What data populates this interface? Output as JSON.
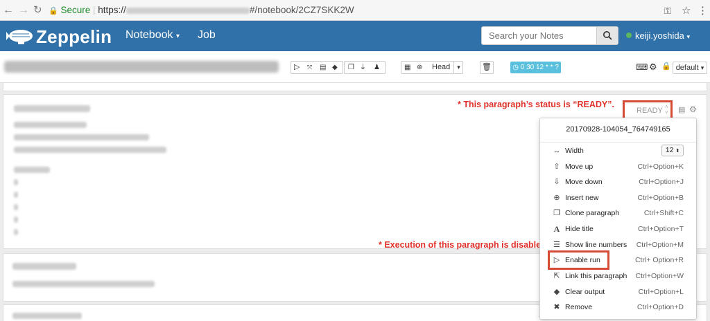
{
  "browser": {
    "secure_label": "Secure",
    "url_scheme": "https://",
    "url_path": "#/notebook/2CZ7SKK2W"
  },
  "navbar": {
    "brand": "Zeppelin",
    "notebook_menu": "Notebook",
    "job_link": "Job",
    "search_placeholder": "Search your Notes",
    "user": "keiji.yoshida",
    "accent_color": "#3071a9"
  },
  "toolbar": {
    "head_label": "Head",
    "cron_label": "0 30 12 * * ?",
    "default_label": "default"
  },
  "annotations": {
    "ready_note": "* This paragraph’s status is “READY”.",
    "disabled_note": "* Execution of this paragraph is disabled."
  },
  "paragraph": {
    "status": "READY"
  },
  "menu": {
    "paragraph_id": "20170928-104054_764749165",
    "width_label": "Width",
    "width_value": "12",
    "items": [
      {
        "icon": "up-arrow-icon",
        "label": "Move up",
        "shortcut": "Ctrl+Option+K"
      },
      {
        "icon": "down-arrow-icon",
        "label": "Move down",
        "shortcut": "Ctrl+Option+J"
      },
      {
        "icon": "plus-icon",
        "label": "Insert new",
        "shortcut": "Ctrl+Option+B"
      },
      {
        "icon": "copy-icon",
        "label": "Clone paragraph",
        "shortcut": "Ctrl+Shift+C"
      },
      {
        "icon": "font-icon",
        "label": "Hide title",
        "shortcut": "Ctrl+Option+T"
      },
      {
        "icon": "list-icon",
        "label": "Show line numbers",
        "shortcut": "Ctrl+Option+M"
      },
      {
        "icon": "play-icon",
        "label": "Enable run",
        "shortcut": "Ctrl+ Option+R"
      },
      {
        "icon": "export-icon",
        "label": "Link this paragraph",
        "shortcut": "Ctrl+Option+W"
      },
      {
        "icon": "eraser-icon",
        "label": "Clear output",
        "shortcut": "Ctrl+Option+L"
      },
      {
        "icon": "remove-icon",
        "label": "Remove",
        "shortcut": "Ctrl+Option+D"
      }
    ]
  }
}
